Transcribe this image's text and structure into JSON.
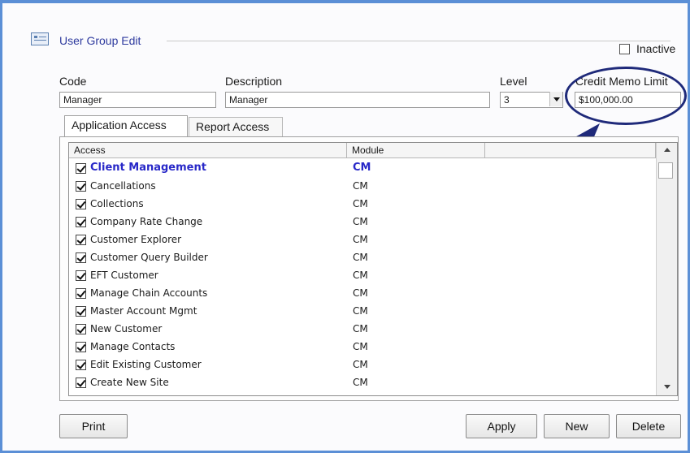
{
  "header": {
    "title": "User Group Edit",
    "inactive_label": "Inactive"
  },
  "form": {
    "code_label": "Code",
    "code_value": "Manager",
    "description_label": "Description",
    "description_value": "Manager",
    "level_label": "Level",
    "level_value": "3",
    "credit_label": "Credit Memo Limit",
    "credit_value": "$100,000.00"
  },
  "tabs": [
    {
      "label": "Application Access",
      "active": true
    },
    {
      "label": "Report Access",
      "active": false
    }
  ],
  "grid": {
    "columns": [
      "Access",
      "Module"
    ],
    "rows": [
      {
        "access": "Client Management",
        "module": "CM",
        "group": true
      },
      {
        "access": "Cancellations",
        "module": "CM"
      },
      {
        "access": "Collections",
        "module": "CM"
      },
      {
        "access": "Company Rate Change",
        "module": "CM"
      },
      {
        "access": "Customer Explorer",
        "module": "CM"
      },
      {
        "access": "Customer Query Builder",
        "module": "CM"
      },
      {
        "access": "EFT Customer",
        "module": "CM"
      },
      {
        "access": "Manage Chain Accounts",
        "module": "CM"
      },
      {
        "access": "Master Account Mgmt",
        "module": "CM"
      },
      {
        "access": "New Customer",
        "module": "CM"
      },
      {
        "access": "Manage Contacts",
        "module": "CM"
      },
      {
        "access": "Edit Existing Customer",
        "module": "CM"
      },
      {
        "access": "Create New Site",
        "module": "CM"
      }
    ]
  },
  "buttons": {
    "print": "Print",
    "apply": "Apply",
    "new": "New",
    "delete": "Delete"
  },
  "colors": {
    "window_border": "#5b8fd6",
    "title": "#2e3a9e",
    "highlight_annotation": "#1f2a7a",
    "group_row": "#2828c8"
  }
}
